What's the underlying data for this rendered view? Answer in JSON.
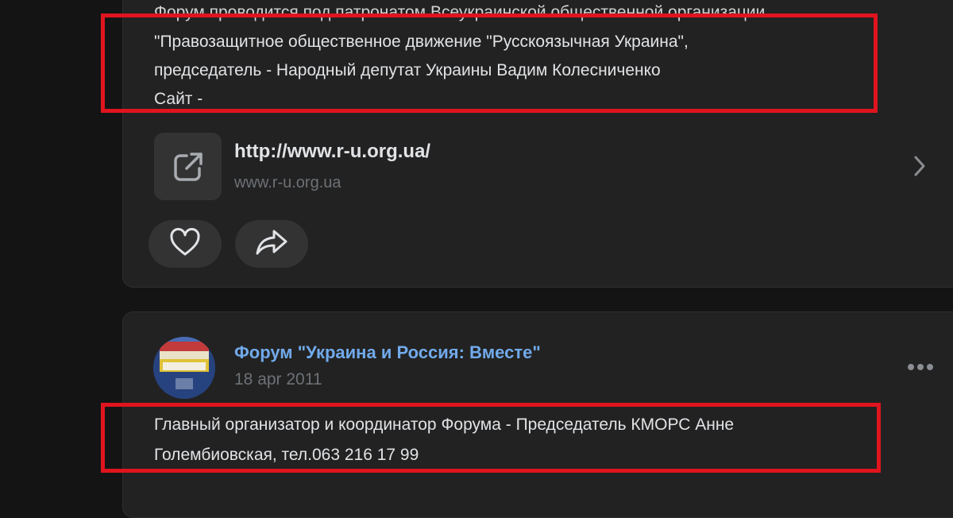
{
  "post1": {
    "text_lines": [
      "Форум проводится под патронатом Всеукраинской общественной организации",
      "\"Правозащитное общественное движение \"Русскоязычная Украина\",",
      "председатель - Народный депутат Украины Вадим Колесниченко",
      "Сайт -"
    ],
    "link": {
      "url": "http://www.r-u.org.ua/",
      "domain": "www.r-u.org.ua",
      "icon": "external-link-icon"
    },
    "actions": {
      "like_icon": "heart-icon",
      "share_icon": "share-icon"
    }
  },
  "post2": {
    "author": "Форум \"Украина и Россия: Вместе\"",
    "date": "18 apr 2011",
    "more_icon": "more-horizontal-icon",
    "text_lines": [
      "Главный организатор и координатор Форума - Председатель КМОРС Анне",
      "Голембиовская, тел.063 216 17 99"
    ]
  },
  "colors": {
    "background": "#141414",
    "card": "#222222",
    "link_accent": "#71aaeb",
    "highlight_box": "#e0141e",
    "muted_text": "#6d7176"
  }
}
